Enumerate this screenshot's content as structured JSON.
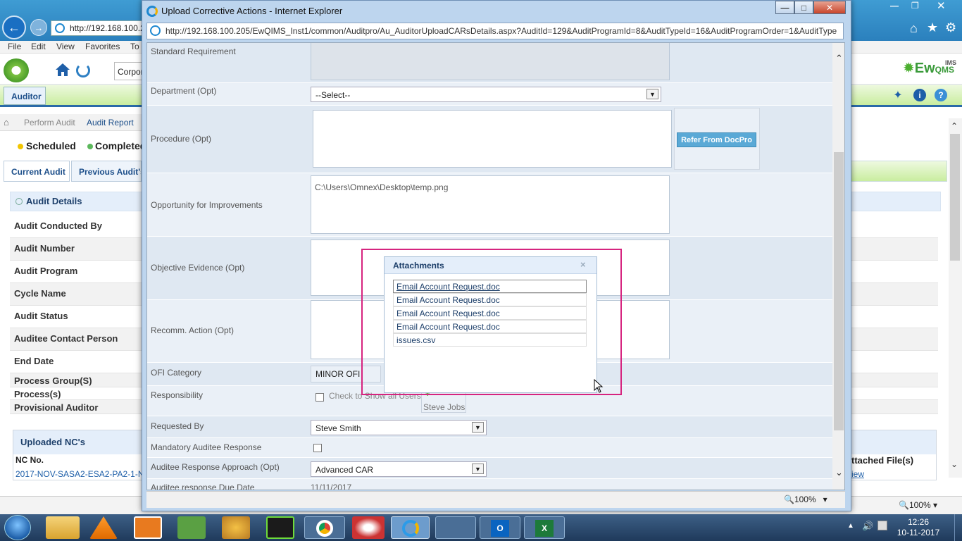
{
  "outer_browser": {
    "address": "http://192.168.100.2",
    "menu": [
      "File",
      "Edit",
      "View",
      "Favorites",
      "To"
    ],
    "corp_field": "Corpor",
    "zoom": "100%"
  },
  "app": {
    "role_tab": "Auditor",
    "logo_text": "Ew",
    "logo_suffix": "QMS",
    "logo_sup": "IMS",
    "breadcrumb": [
      "Perform Audit",
      "Audit Report"
    ],
    "legend": {
      "scheduled": "Scheduled",
      "completed": "Completed"
    },
    "tabs": [
      "Current Audit",
      "Previous Audit's"
    ],
    "audit_details_title": "Audit Details",
    "detail_labels": [
      "Audit Conducted By",
      "Audit Number",
      "Audit Program",
      "Cycle Name",
      "Audit Status",
      "Auditee Contact Person",
      "End Date",
      "Process Group(S)",
      "Process(s)",
      "Provisional Auditor"
    ],
    "uploaded_title": "Uploaded NC's",
    "nc_col": "NC No.",
    "nc_value": "2017-NOV-SASA2-ESA2-PA2-1-NC",
    "attached_col": "ttached File(s)",
    "attached_value": "iew"
  },
  "popup": {
    "title": "Upload Corrective Actions - Internet Explorer",
    "url": "http://192.168.100.205/EwQIMS_Inst1/common/Auditpro/Au_AuditorUploadCARsDetails.aspx?AuditId=129&AuditProgramId=8&AuditTypeId=16&AuditProgramOrder=1&AuditType",
    "zoom": "100%",
    "fields": {
      "standard_requirement": "Standard Requirement",
      "department": "Department (Opt)",
      "department_value": "--Select--",
      "procedure": "Procedure (Opt)",
      "refer_btn": "Refer From DocPro",
      "ofi": "Opportunity for Improvements",
      "ofi_value": "C:\\Users\\Omnex\\Desktop\\temp.png",
      "objective": "Objective Evidence (Opt)",
      "recomm": "Recomm. Action (Opt)",
      "ofi_category": "OFI Category",
      "ofi_category_value": "MINOR OFI",
      "responsibility": "Responsibility",
      "show_all_users": "Check to Show all Users",
      "responsible_user": "Steve Jobs",
      "requested_by": "Requested By",
      "requested_by_value": "Steve Smith",
      "mandatory": "Mandatory Auditee Response",
      "approach": "Auditee Response Approach (Opt)",
      "approach_value": "Advanced CAR",
      "due_date": "Auditee response Due Date",
      "due_date_value": "11/11/2017"
    }
  },
  "attachments": {
    "title": "Attachments",
    "close": "×",
    "items": [
      "Email Account Request.doc",
      "Email Account Request.doc",
      "Email Account Request.doc",
      "Email Account Request.doc",
      "issues.csv"
    ]
  },
  "taskbar": {
    "time": "12:26",
    "date": "10-11-2017"
  }
}
